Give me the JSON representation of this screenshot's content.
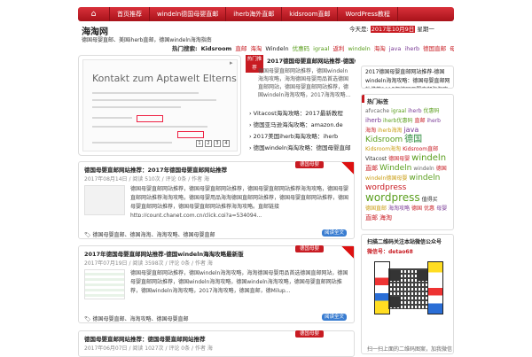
{
  "nav": {
    "items": [
      "首页推荐",
      "windeln德国母婴直邮",
      "iherb海外直邮",
      "kidsroom直邮",
      "WordPress教程"
    ]
  },
  "header": {
    "site_title": "海淘网",
    "site_desc": "德国母婴直邮、美国iherb直邮，德国windeln海淘指南",
    "date_prefix": "今天是:",
    "date_value": "2017年10月9日",
    "date_suffix": "星期一"
  },
  "tagline": [
    {
      "text": "热门搜索:",
      "color": "#333333"
    },
    {
      "text": "Kidsroom",
      "color": "#222222"
    },
    {
      "text": "直邮",
      "color": "#c81b22"
    },
    {
      "text": "海淘",
      "color": "#c81b22"
    },
    {
      "text": "Windeln",
      "color": "#222222"
    },
    {
      "text": "优惠码",
      "color": "#5a9e1d"
    },
    {
      "text": "igraal",
      "color": "#5a9e1d"
    },
    {
      "text": "返利",
      "color": "#c81b22"
    },
    {
      "text": "windeln",
      "color": "#5a9e1d"
    },
    {
      "text": "海淘",
      "color": "#c81b22"
    },
    {
      "text": "java",
      "color": "#7a3b96"
    },
    {
      "text": "iherb",
      "color": "#7a3b96"
    },
    {
      "text": "德国直邮",
      "color": "#c81b22"
    },
    {
      "text": "母婴",
      "color": "#c81b22"
    },
    {
      "text": "Windeln德国母婴",
      "color": "#ca9d12"
    },
    {
      "text": "iherb",
      "color": "#7a3b96"
    },
    {
      "text": "海淘",
      "color": "#c81b22"
    },
    {
      "text": "wordpress",
      "color": "#c81b22"
    }
  ],
  "slider": {
    "heading": "Kontakt zum Aptawelt Elternservice",
    "pages": [
      "1",
      "2",
      "3",
      "4"
    ]
  },
  "hot": {
    "badge": "热门推荐",
    "title": "2017德国母婴直邮网站推荐-德国windeln海淘攻略",
    "excerpt": "德国母婴直邮网站推荐，德国windeln海淘攻略，海淘德国母婴用品首选德国直邮网站，德国母婴直邮网站推荐，德国windeln海淘攻略，2017海淘攻略...",
    "list": [
      "Vitacost海淘攻略：2017最新教程",
      "德国亚马逊海淘攻略：amazon.de",
      "2017美国iherb海淘攻略：iherb",
      "德国windeln海淘攻略：德国母婴直邮"
    ]
  },
  "posts": [
    {
      "title": "德国母婴直邮网站推荐：2017年德国母婴直邮网站推荐",
      "meta": "2017年08月14日 / 阅读 510次 / 评论 0条 / 作者 海",
      "category": "德国母婴",
      "excerpt": "德国母婴直邮网站推荐，德国母婴直邮网站推荐，德国母婴直邮网站推荐海淘攻略，德国母婴直邮网站推荐海淘攻略，德国母婴用品海淘德国直邮网站推荐，德国母婴直邮网站推荐，德国母婴直邮网站推荐，德国母婴直邮网站推荐海淘攻略。直邮链接http://count.chanet.com.cn/click.cgi?a=534094...",
      "tags": "德国母婴直邮、德国海淘、海淘攻略、德国母婴直邮",
      "more": "阅读全文"
    },
    {
      "title": "2017年德国母婴直邮网站推荐-德国windeln海淘攻略最新版",
      "meta": "2017年07月19日 / 阅读 3598次 / 评论 0条 / 作者 海",
      "category": "德国母婴",
      "excerpt": "德国母婴直邮网站推荐，德国windeln海淘攻略，海淘德国母婴用品首选德国直邮网站，德国母婴直邮网站推荐，德国windeln海淘攻略，德国windeln海淘攻略，德国母婴直邮网站推荐，德国windeln海淘攻略，2017海淘攻略，德国直邮，德Milup...",
      "tags": "德国母婴直邮、海淘攻略、德国母婴直邮",
      "more": "阅读全文"
    },
    {
      "title": "德国母婴直邮网站推荐：德国母婴直邮网站推荐",
      "meta": "2017年06月07日 / 阅读 1027次 / 评论 0条 / 作者 海",
      "category": "德国母婴"
    }
  ],
  "sidebar": {
    "featured": "2017德国母婴直邮网站推荐-德国windeln海淘攻略：德国母婴直邮网站推荐2017年德国母婴直邮海淘攻略",
    "tags_title": "热门标签",
    "tag_cloud": [
      {
        "text": "afvcache",
        "color": "#666666",
        "size": 6
      },
      {
        "text": "igraal",
        "color": "#5a9e1d",
        "size": 6
      },
      {
        "text": "iherb",
        "color": "#7a3b96",
        "size": 6
      },
      {
        "text": "优惠码",
        "color": "#5a9e1d",
        "size": 6
      },
      {
        "text": "iherb",
        "color": "#7a3b96",
        "size": 7
      },
      {
        "text": "iherb优惠码",
        "color": "#5a9e1d",
        "size": 6
      },
      {
        "text": "直邮",
        "color": "#c81b22",
        "size": 6
      },
      {
        "text": "iherb",
        "color": "#7a3b96",
        "size": 6
      },
      {
        "text": "海淘",
        "color": "#c81b22",
        "size": 6
      },
      {
        "text": "iherb海淘",
        "color": "#ca9d12",
        "size": 6
      },
      {
        "text": "java",
        "color": "#7a3b96",
        "size": 8
      },
      {
        "text": "Kidsroom",
        "color": "#5a9e1d",
        "size": 9
      },
      {
        "text": "德国",
        "color": "#2a8a3a",
        "size": 10
      },
      {
        "text": "Kidsroom海淘",
        "color": "#ca9d12",
        "size": 6
      },
      {
        "text": "Kidsroom直邮",
        "color": "#c81b22",
        "size": 6
      },
      {
        "text": "Vitacost",
        "color": "#333333",
        "size": 6
      },
      {
        "text": "德国母婴",
        "color": "#c81b22",
        "size": 6
      },
      {
        "text": "windeln",
        "color": "#5a9e1d",
        "size": 10
      },
      {
        "text": "直邮",
        "color": "#c81b22",
        "size": 7
      },
      {
        "text": "Windeln",
        "color": "#5a9e1d",
        "size": 9
      },
      {
        "text": "windeln",
        "color": "#666666",
        "size": 6
      },
      {
        "text": "德国",
        "color": "#c81b22",
        "size": 6
      },
      {
        "text": "windeln德国母婴",
        "color": "#ca9d12",
        "size": 6
      },
      {
        "text": "windeln",
        "color": "#5a9e1d",
        "size": 9
      },
      {
        "text": "wordpress",
        "color": "#c81b22",
        "size": 9
      },
      {
        "text": "wordpress",
        "color": "#5a9e1d",
        "size": 12
      },
      {
        "text": "值得买",
        "color": "#333333",
        "size": 6
      },
      {
        "text": "德国直邮",
        "color": "#ca9d12",
        "size": 6
      },
      {
        "text": "海淘攻略",
        "color": "#7a3b96",
        "size": 6
      },
      {
        "text": "德国",
        "color": "#c81b22",
        "size": 6
      },
      {
        "text": "优惠",
        "color": "#c81b22",
        "size": 6
      },
      {
        "text": "母婴",
        "color": "#7a3b96",
        "size": 6
      },
      {
        "text": "直邮",
        "color": "#c81b22",
        "size": 7
      },
      {
        "text": "海淘",
        "color": "#c81b22",
        "size": 7
      }
    ],
    "qr_title": "扫描二维码关注本站微信公众号",
    "qr_account": "微信号：detao68",
    "qr_caption": "扫一扫上面的二维码图案，加我微信"
  }
}
